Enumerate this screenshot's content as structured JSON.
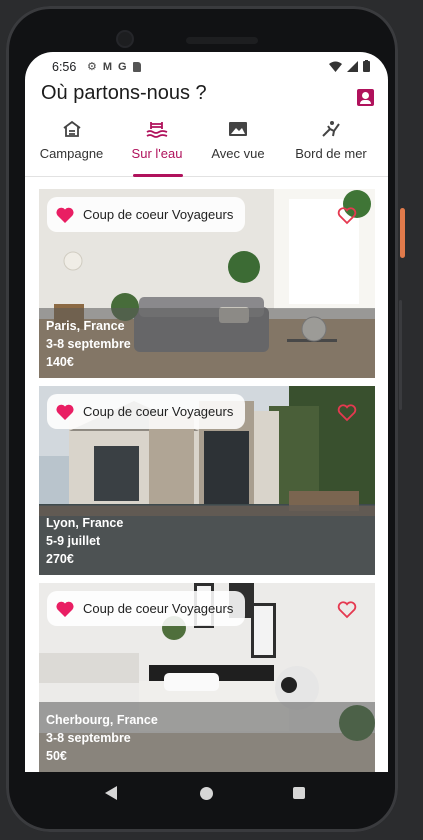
{
  "status_bar": {
    "time": "6:56",
    "icons": [
      "gear-icon",
      "gmail-icon",
      "google-icon",
      "sd-card-icon"
    ]
  },
  "header": {
    "title": "Où partons-nous ?"
  },
  "tabs": [
    {
      "label": "Campagne",
      "icon": "house-icon"
    },
    {
      "label": "Sur l'eau",
      "icon": "pool-icon",
      "active": true
    },
    {
      "label": "Avec vue",
      "icon": "landscape-image-icon"
    },
    {
      "label": "Bord de mer",
      "icon": "surfing-icon"
    }
  ],
  "listings": [
    {
      "badge": "Coup de coeur Voyageurs",
      "city": "Paris, France",
      "dates": "3-8 septembre",
      "price": "140€"
    },
    {
      "badge": "Coup de coeur Voyageurs",
      "city": "Lyon, France",
      "dates": "5-9 juillet",
      "price": "270€"
    },
    {
      "badge": "Coup de coeur Voyageurs",
      "city": "Cherbourg, France",
      "dates": "3-8 septembre",
      "price": "50€"
    }
  ],
  "colors": {
    "accent": "#b0125c",
    "favorite": "#e91e63",
    "heart_outline": "#e53950"
  }
}
